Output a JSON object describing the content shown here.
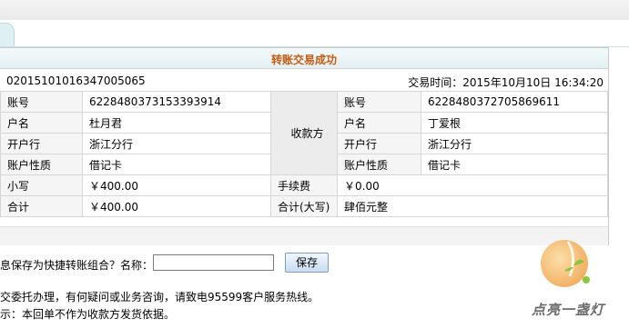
{
  "receipt": {
    "title": "转账交易成功",
    "serial_no": "02015101016347005065",
    "tx_time_label": "交易时间：",
    "tx_time": "2015年10月10日 16:34:20",
    "payee_label": "收款方",
    "payer": {
      "account_label": "账号",
      "account": "6228480373153393914",
      "name_label": "户名",
      "name": "杜月君",
      "bank_label": "开户行",
      "bank": "浙江分行",
      "type_label": "账户性质",
      "type": "借记卡"
    },
    "payee": {
      "account_label": "账号",
      "account": "6228480372705869611",
      "name_label": "户名",
      "name": "丁爱根",
      "bank_label": "开户行",
      "bank": "浙江分行",
      "type_label": "账户性质",
      "type": "借记卡"
    },
    "amount_label": "小写",
    "amount": "￥400.00",
    "fee_label": "手续费",
    "fee": "￥0.00",
    "total_label": "合计",
    "total": "￥400.00",
    "total_caps_label": "合计(大写)",
    "total_caps": "肆佰元整"
  },
  "quick_save": {
    "question": "息保存为快捷转账组合？名称：",
    "name_value": "",
    "save_label": "保存"
  },
  "notices": {
    "line1": "交委托办理，有何疑问或业务咨询，请致电95599客户服务热线。",
    "line2": "示：本回单不作为收款方发货依据。"
  },
  "watermark": {
    "text": "点亮一盏灯"
  },
  "colors": {
    "title": "#c55a11",
    "border": "#d6d6d6",
    "label_bg": "#f5f5f5"
  }
}
